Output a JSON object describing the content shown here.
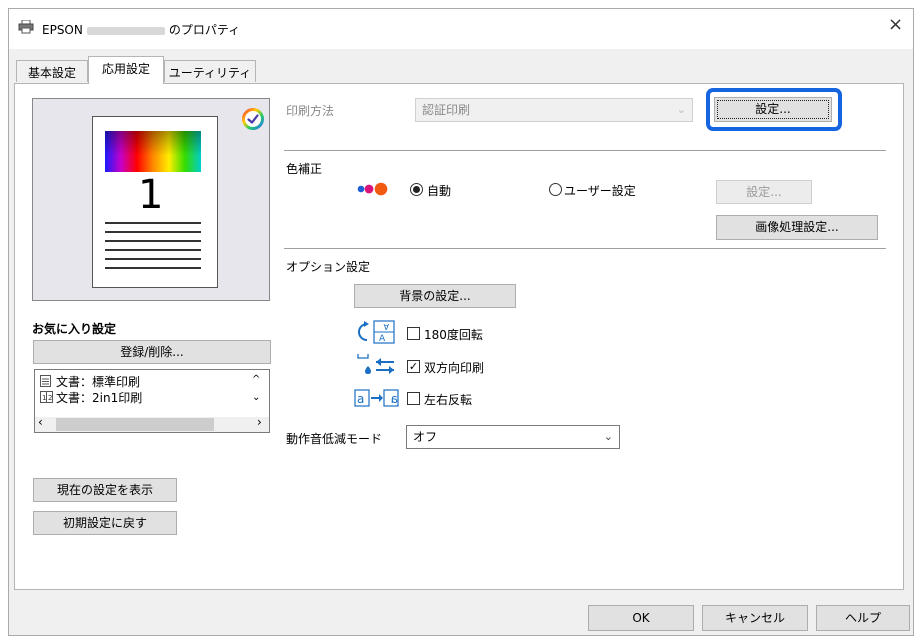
{
  "window": {
    "title_prefix": "EPSON",
    "title_suffix": "のプロパティ",
    "close_glyph": "×"
  },
  "tabs": [
    {
      "label": "基本設定"
    },
    {
      "label": "応用設定"
    },
    {
      "label": "ユーティリティー"
    }
  ],
  "preview": {
    "page_number": "1"
  },
  "favorites": {
    "heading": "お気に入り設定",
    "register_button": "登録/削除...",
    "items": [
      {
        "label": "文書：標準印刷"
      },
      {
        "label": "文書：2in1印刷"
      }
    ]
  },
  "left_buttons": {
    "show_current": "現在の設定を表示",
    "reset_default": "初期設定に戻す"
  },
  "print_method": {
    "label": "印刷方法",
    "value": "認証印刷",
    "settings_button": "設定..."
  },
  "color_correction": {
    "heading": "色補正",
    "auto_label": "自動",
    "user_label": "ユーザー設定",
    "settings_button": "設定...",
    "image_settings_button": "画像処理設定...",
    "selected": "自動"
  },
  "options": {
    "heading": "オプション設定",
    "background_button": "背景の設定...",
    "rotate_180": {
      "label": "180度回転",
      "checked": false
    },
    "bidirectional": {
      "label": "双方向印刷",
      "checked": true
    },
    "mirror": {
      "label": "左右反転",
      "checked": false
    }
  },
  "quiet_mode": {
    "label": "動作音低減モード",
    "value": "オフ"
  },
  "footer": {
    "ok": "OK",
    "cancel": "キャンセル",
    "help": "ヘルプ"
  },
  "colors": {
    "accent": "#1565e0",
    "panel_bg": "#f0f0f0"
  }
}
